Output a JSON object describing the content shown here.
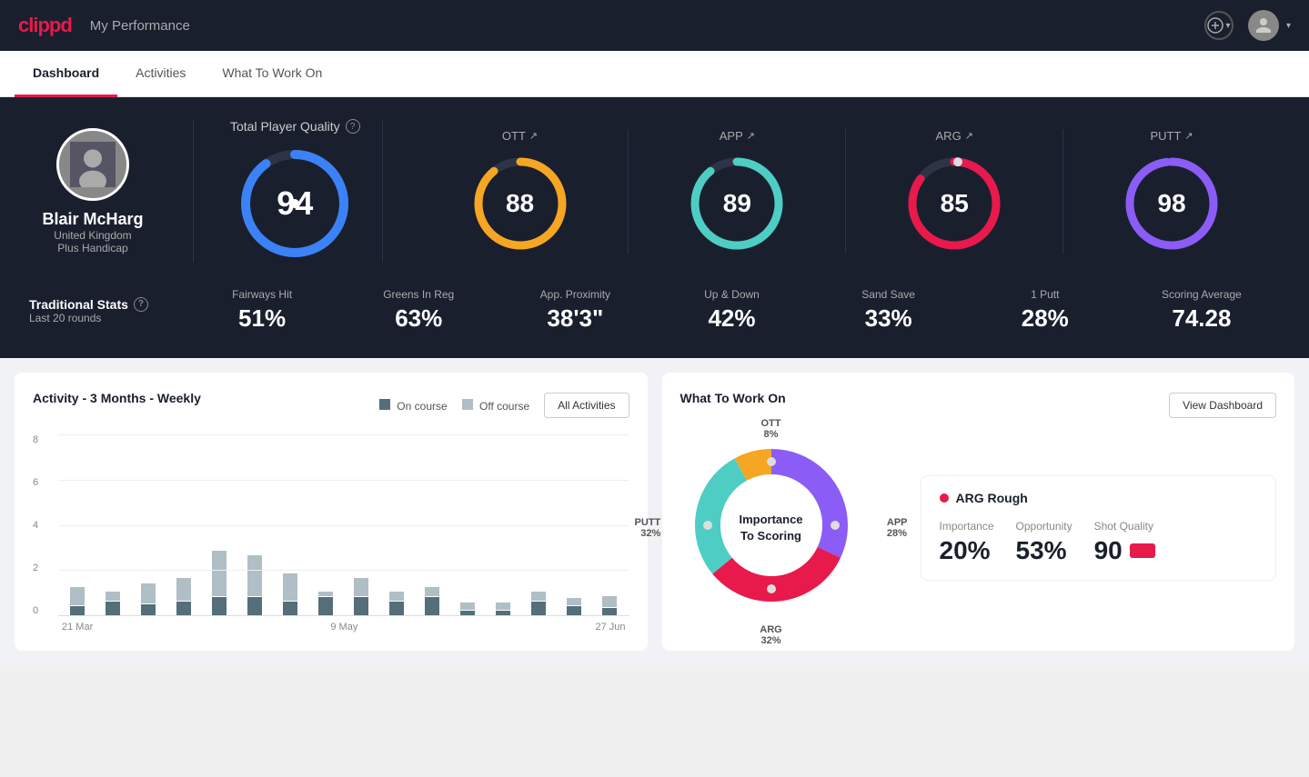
{
  "app": {
    "logo": "clippd",
    "header_title": "My Performance"
  },
  "tabs": [
    {
      "id": "dashboard",
      "label": "Dashboard",
      "active": true
    },
    {
      "id": "activities",
      "label": "Activities",
      "active": false
    },
    {
      "id": "what-to-work-on",
      "label": "What To Work On",
      "active": false
    }
  ],
  "player": {
    "name": "Blair McHarg",
    "country": "United Kingdom",
    "handicap": "Plus Handicap"
  },
  "quality": {
    "total_label": "Total Player Quality",
    "total_value": "94",
    "metrics": [
      {
        "id": "ott",
        "label": "OTT",
        "value": "88",
        "color_stroke": "#f5a623",
        "color_track": "#2e3447",
        "pct": 0.88
      },
      {
        "id": "app",
        "label": "APP",
        "value": "89",
        "color_stroke": "#4ecdc4",
        "color_track": "#2e3447",
        "pct": 0.89
      },
      {
        "id": "arg",
        "label": "ARG",
        "value": "85",
        "color_stroke": "#e8194b",
        "color_track": "#2e3447",
        "pct": 0.85
      },
      {
        "id": "putt",
        "label": "PUTT",
        "value": "98",
        "color_stroke": "#8b5cf6",
        "color_track": "#2e3447",
        "pct": 0.98
      }
    ]
  },
  "traditional_stats": {
    "title": "Traditional Stats",
    "subtitle": "Last 20 rounds",
    "stats": [
      {
        "name": "Fairways Hit",
        "value": "51%"
      },
      {
        "name": "Greens In Reg",
        "value": "63%"
      },
      {
        "name": "App. Proximity",
        "value": "38'3\""
      },
      {
        "name": "Up & Down",
        "value": "42%"
      },
      {
        "name": "Sand Save",
        "value": "33%"
      },
      {
        "name": "1 Putt",
        "value": "28%"
      },
      {
        "name": "Scoring Average",
        "value": "74.28"
      }
    ]
  },
  "activity_chart": {
    "title": "Activity - 3 Months - Weekly",
    "legend_on": "On course",
    "legend_off": "Off course",
    "button": "All Activities",
    "y_labels": [
      "8",
      "6",
      "4",
      "2",
      "0"
    ],
    "x_labels": [
      "21 Mar",
      "9 May",
      "27 Jun"
    ],
    "bars": [
      {
        "on": 10,
        "off": 20
      },
      {
        "on": 15,
        "off": 10
      },
      {
        "on": 12,
        "off": 22
      },
      {
        "on": 15,
        "off": 25
      },
      {
        "on": 20,
        "off": 50
      },
      {
        "on": 20,
        "off": 45
      },
      {
        "on": 15,
        "off": 30
      },
      {
        "on": 20,
        "off": 5
      },
      {
        "on": 20,
        "off": 20
      },
      {
        "on": 15,
        "off": 10
      },
      {
        "on": 20,
        "off": 10
      },
      {
        "on": 5,
        "off": 8
      },
      {
        "on": 5,
        "off": 8
      },
      {
        "on": 15,
        "off": 10
      },
      {
        "on": 10,
        "off": 8
      },
      {
        "on": 8,
        "off": 12
      }
    ]
  },
  "what_to_work_on": {
    "title": "What To Work On",
    "button": "View Dashboard",
    "donut": {
      "center_line1": "Importance",
      "center_line2": "To Scoring",
      "segments": [
        {
          "id": "ott",
          "label": "OTT",
          "pct": "8%",
          "color": "#f5a623",
          "value": 8
        },
        {
          "id": "app",
          "label": "APP",
          "pct": "28%",
          "color": "#4ecdc4",
          "value": 28
        },
        {
          "id": "arg",
          "label": "ARG",
          "pct": "32%",
          "color": "#e8194b",
          "value": 32
        },
        {
          "id": "putt",
          "label": "PUTT",
          "pct": "32%",
          "color": "#8b5cf6",
          "value": 32
        }
      ]
    },
    "detail_card": {
      "indicator_color": "#e8194b",
      "title": "ARG Rough",
      "metrics": [
        {
          "name": "Importance",
          "value": "20%"
        },
        {
          "name": "Opportunity",
          "value": "53%"
        },
        {
          "name": "Shot Quality",
          "value": "90",
          "has_swatch": true,
          "swatch_color": "#e8194b"
        }
      ]
    }
  },
  "colors": {
    "brand_red": "#e8194b",
    "dark_bg": "#1a1f2e",
    "card_border": "#2e3447",
    "total_quality_stroke": "#3b82f6"
  }
}
